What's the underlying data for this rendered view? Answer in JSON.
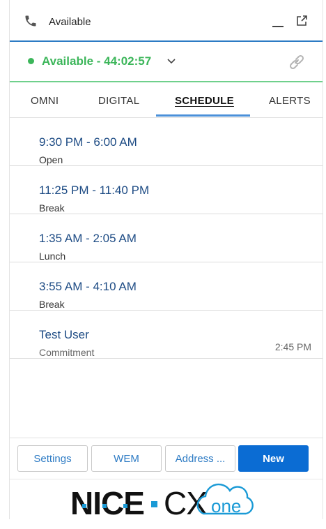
{
  "header": {
    "title": "Available",
    "icon": "phone-icon"
  },
  "status": {
    "text": "Available - 44:02:57",
    "color": "#3cb65a"
  },
  "tabs": [
    {
      "label": "OMNI",
      "active": false
    },
    {
      "label": "DIGITAL",
      "active": false
    },
    {
      "label": "SCHEDULE",
      "active": true
    },
    {
      "label": "ALERTS",
      "active": false
    }
  ],
  "schedule": [
    {
      "title": "9:30 PM - 6:00 AM",
      "sub": "Open",
      "time": ""
    },
    {
      "title": "11:25 PM - 11:40 PM",
      "sub": "Break",
      "time": ""
    },
    {
      "title": "1:35 AM - 2:05 AM",
      "sub": "Lunch",
      "time": ""
    },
    {
      "title": "3:55 AM - 4:10 AM",
      "sub": "Break",
      "time": ""
    },
    {
      "title": "Test User",
      "sub": "Commitment",
      "time": "2:45 PM"
    }
  ],
  "footer": {
    "settings_label": "Settings",
    "wem_label": "WEM",
    "address_label": "Address ...",
    "new_label": "New"
  },
  "logo": {
    "word1": "NICE",
    "word2": "CX",
    "word3": "one",
    "accent": "#1a9ad6"
  },
  "colors": {
    "accent": "#2d7bc4",
    "primary_button": "#0b6cd3",
    "title_blue": "#1d4b84"
  }
}
